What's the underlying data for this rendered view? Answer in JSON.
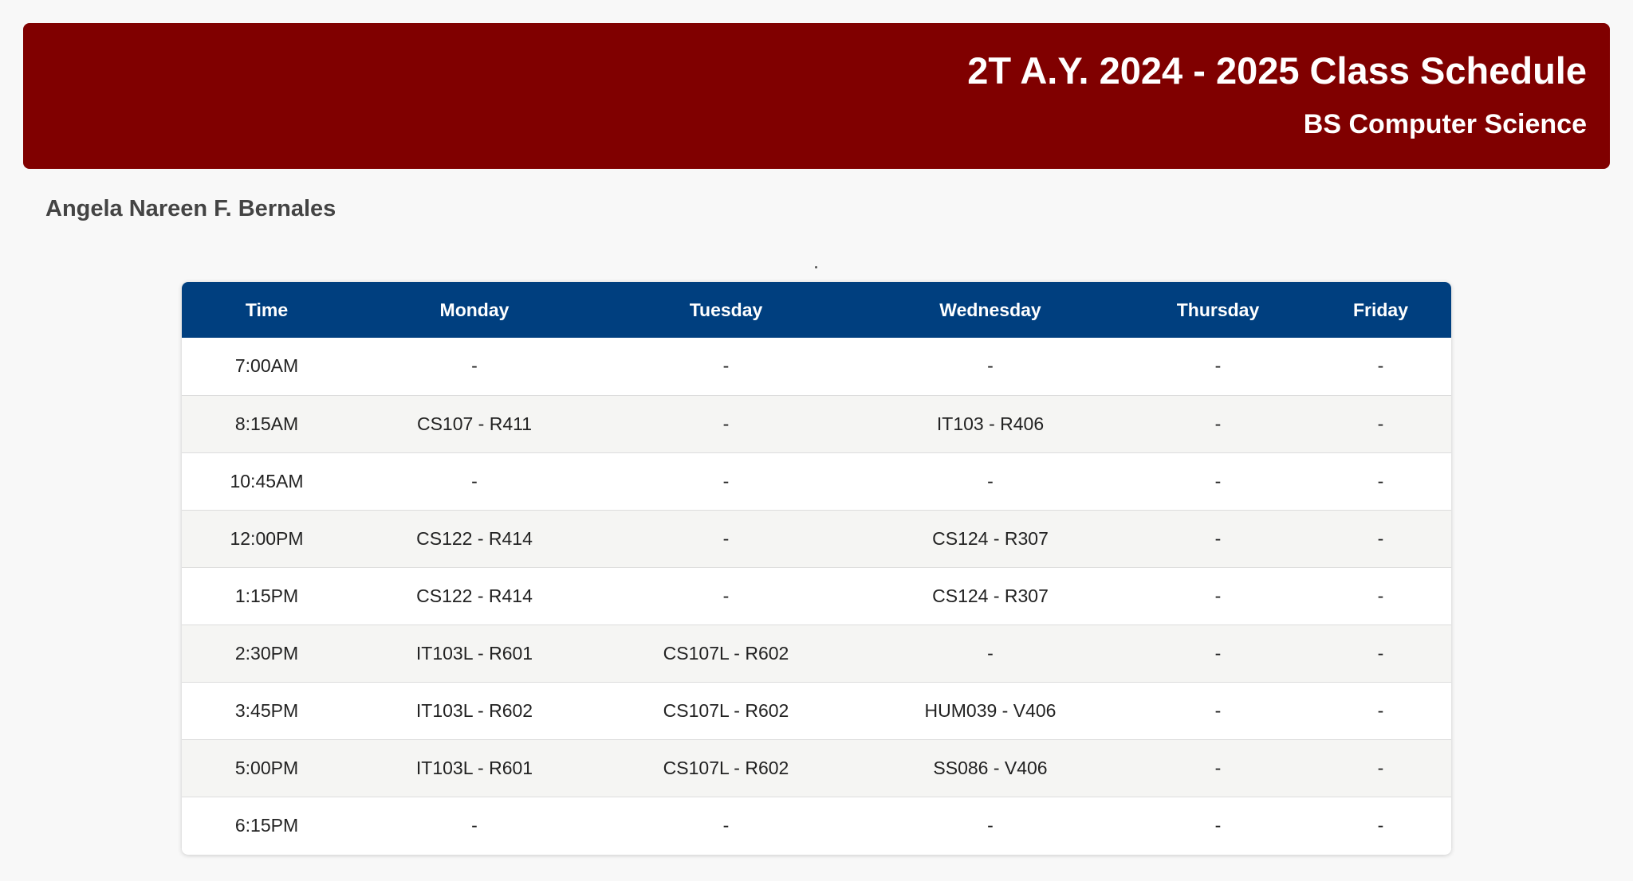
{
  "header": {
    "title": "2T A.Y. 2024 - 2025 Class Schedule",
    "subtitle": "BS Computer Science",
    "background": "#800000"
  },
  "student": {
    "name": "Angela Nareen F. Bernales"
  },
  "separator_mark": ".",
  "table": {
    "header_color": "#003f7f",
    "columns": [
      "Time",
      "Monday",
      "Tuesday",
      "Wednesday",
      "Thursday",
      "Friday"
    ],
    "rows": [
      [
        "7:00AM",
        "-",
        "-",
        "-",
        "-",
        "-"
      ],
      [
        "8:15AM",
        "CS107 - R411",
        "-",
        "IT103 - R406",
        "-",
        "-"
      ],
      [
        "10:45AM",
        "-",
        "-",
        "-",
        "-",
        "-"
      ],
      [
        "12:00PM",
        "CS122 - R414",
        "-",
        "CS124 - R307",
        "-",
        "-"
      ],
      [
        "1:15PM",
        "CS122 - R414",
        "-",
        "CS124 - R307",
        "-",
        "-"
      ],
      [
        "2:30PM",
        "IT103L - R601",
        "CS107L - R602",
        "-",
        "-",
        "-"
      ],
      [
        "3:45PM",
        "IT103L - R602",
        "CS107L - R602",
        "HUM039 - V406",
        "-",
        "-"
      ],
      [
        "5:00PM",
        "IT103L - R601",
        "CS107L - R602",
        "SS086 - V406",
        "-",
        "-"
      ],
      [
        "6:15PM",
        "-",
        "-",
        "-",
        "-",
        "-"
      ]
    ]
  }
}
